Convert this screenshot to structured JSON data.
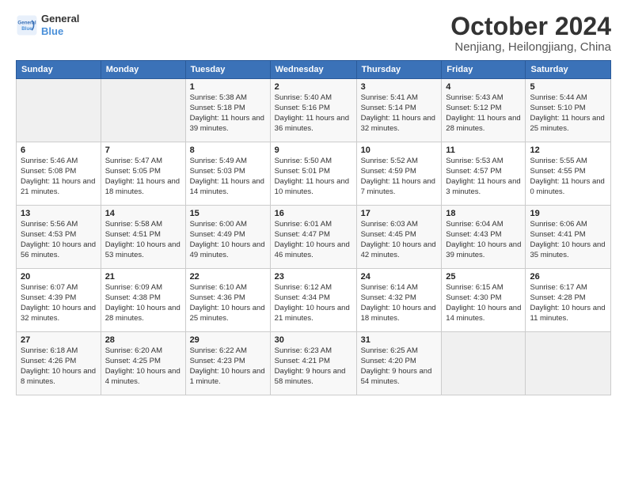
{
  "header": {
    "logo_line1": "General",
    "logo_line2": "Blue",
    "month": "October 2024",
    "location": "Nenjiang, Heilongjiang, China"
  },
  "weekdays": [
    "Sunday",
    "Monday",
    "Tuesday",
    "Wednesday",
    "Thursday",
    "Friday",
    "Saturday"
  ],
  "weeks": [
    [
      {
        "day": "",
        "info": ""
      },
      {
        "day": "",
        "info": ""
      },
      {
        "day": "1",
        "info": "Sunrise: 5:38 AM\nSunset: 5:18 PM\nDaylight: 11 hours and 39 minutes."
      },
      {
        "day": "2",
        "info": "Sunrise: 5:40 AM\nSunset: 5:16 PM\nDaylight: 11 hours and 36 minutes."
      },
      {
        "day": "3",
        "info": "Sunrise: 5:41 AM\nSunset: 5:14 PM\nDaylight: 11 hours and 32 minutes."
      },
      {
        "day": "4",
        "info": "Sunrise: 5:43 AM\nSunset: 5:12 PM\nDaylight: 11 hours and 28 minutes."
      },
      {
        "day": "5",
        "info": "Sunrise: 5:44 AM\nSunset: 5:10 PM\nDaylight: 11 hours and 25 minutes."
      }
    ],
    [
      {
        "day": "6",
        "info": "Sunrise: 5:46 AM\nSunset: 5:08 PM\nDaylight: 11 hours and 21 minutes."
      },
      {
        "day": "7",
        "info": "Sunrise: 5:47 AM\nSunset: 5:05 PM\nDaylight: 11 hours and 18 minutes."
      },
      {
        "day": "8",
        "info": "Sunrise: 5:49 AM\nSunset: 5:03 PM\nDaylight: 11 hours and 14 minutes."
      },
      {
        "day": "9",
        "info": "Sunrise: 5:50 AM\nSunset: 5:01 PM\nDaylight: 11 hours and 10 minutes."
      },
      {
        "day": "10",
        "info": "Sunrise: 5:52 AM\nSunset: 4:59 PM\nDaylight: 11 hours and 7 minutes."
      },
      {
        "day": "11",
        "info": "Sunrise: 5:53 AM\nSunset: 4:57 PM\nDaylight: 11 hours and 3 minutes."
      },
      {
        "day": "12",
        "info": "Sunrise: 5:55 AM\nSunset: 4:55 PM\nDaylight: 11 hours and 0 minutes."
      }
    ],
    [
      {
        "day": "13",
        "info": "Sunrise: 5:56 AM\nSunset: 4:53 PM\nDaylight: 10 hours and 56 minutes."
      },
      {
        "day": "14",
        "info": "Sunrise: 5:58 AM\nSunset: 4:51 PM\nDaylight: 10 hours and 53 minutes."
      },
      {
        "day": "15",
        "info": "Sunrise: 6:00 AM\nSunset: 4:49 PM\nDaylight: 10 hours and 49 minutes."
      },
      {
        "day": "16",
        "info": "Sunrise: 6:01 AM\nSunset: 4:47 PM\nDaylight: 10 hours and 46 minutes."
      },
      {
        "day": "17",
        "info": "Sunrise: 6:03 AM\nSunset: 4:45 PM\nDaylight: 10 hours and 42 minutes."
      },
      {
        "day": "18",
        "info": "Sunrise: 6:04 AM\nSunset: 4:43 PM\nDaylight: 10 hours and 39 minutes."
      },
      {
        "day": "19",
        "info": "Sunrise: 6:06 AM\nSunset: 4:41 PM\nDaylight: 10 hours and 35 minutes."
      }
    ],
    [
      {
        "day": "20",
        "info": "Sunrise: 6:07 AM\nSunset: 4:39 PM\nDaylight: 10 hours and 32 minutes."
      },
      {
        "day": "21",
        "info": "Sunrise: 6:09 AM\nSunset: 4:38 PM\nDaylight: 10 hours and 28 minutes."
      },
      {
        "day": "22",
        "info": "Sunrise: 6:10 AM\nSunset: 4:36 PM\nDaylight: 10 hours and 25 minutes."
      },
      {
        "day": "23",
        "info": "Sunrise: 6:12 AM\nSunset: 4:34 PM\nDaylight: 10 hours and 21 minutes."
      },
      {
        "day": "24",
        "info": "Sunrise: 6:14 AM\nSunset: 4:32 PM\nDaylight: 10 hours and 18 minutes."
      },
      {
        "day": "25",
        "info": "Sunrise: 6:15 AM\nSunset: 4:30 PM\nDaylight: 10 hours and 14 minutes."
      },
      {
        "day": "26",
        "info": "Sunrise: 6:17 AM\nSunset: 4:28 PM\nDaylight: 10 hours and 11 minutes."
      }
    ],
    [
      {
        "day": "27",
        "info": "Sunrise: 6:18 AM\nSunset: 4:26 PM\nDaylight: 10 hours and 8 minutes."
      },
      {
        "day": "28",
        "info": "Sunrise: 6:20 AM\nSunset: 4:25 PM\nDaylight: 10 hours and 4 minutes."
      },
      {
        "day": "29",
        "info": "Sunrise: 6:22 AM\nSunset: 4:23 PM\nDaylight: 10 hours and 1 minute."
      },
      {
        "day": "30",
        "info": "Sunrise: 6:23 AM\nSunset: 4:21 PM\nDaylight: 9 hours and 58 minutes."
      },
      {
        "day": "31",
        "info": "Sunrise: 6:25 AM\nSunset: 4:20 PM\nDaylight: 9 hours and 54 minutes."
      },
      {
        "day": "",
        "info": ""
      },
      {
        "day": "",
        "info": ""
      }
    ]
  ]
}
